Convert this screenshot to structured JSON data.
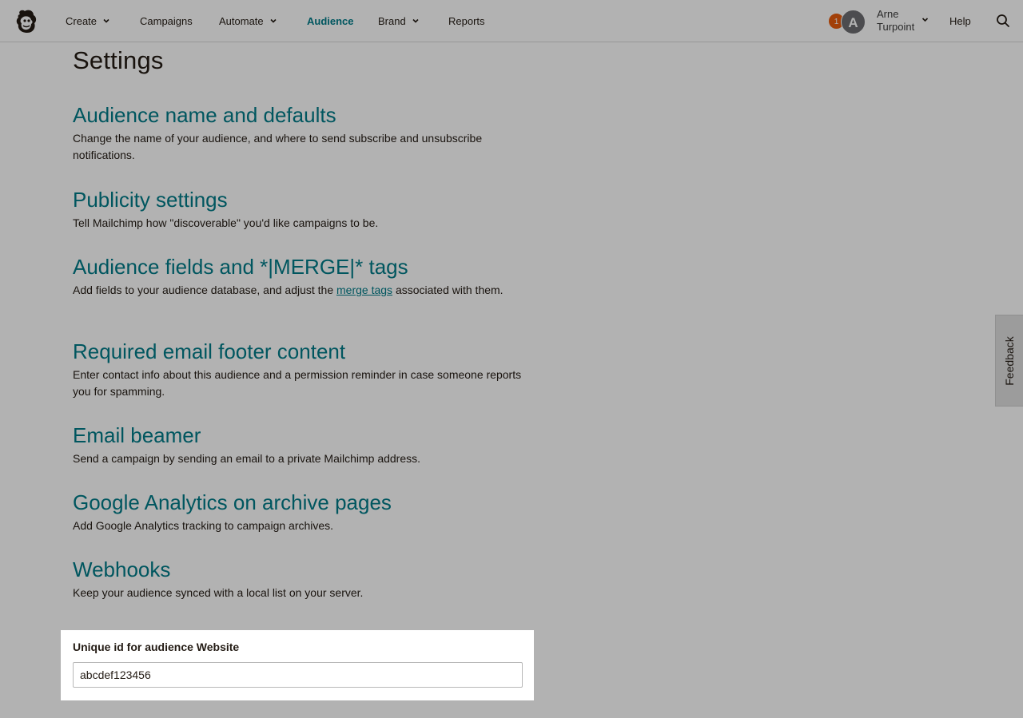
{
  "nav": {
    "logo": "mailchimp-logo",
    "items": [
      {
        "label": "Create",
        "has_dropdown": true
      },
      {
        "label": "Campaigns",
        "has_dropdown": false
      },
      {
        "label": "Automate",
        "has_dropdown": true
      },
      {
        "label": "Audience",
        "has_dropdown": false,
        "active": true
      },
      {
        "label": "Brand",
        "has_dropdown": true
      },
      {
        "label": "Reports",
        "has_dropdown": false
      }
    ],
    "notification_count": "1",
    "avatar_initial": "A",
    "user_first": "Arne",
    "user_last": "Turpoint",
    "help": "Help",
    "search_icon": "search-icon"
  },
  "page": {
    "title": "Settings",
    "sections": [
      {
        "title": "Audience name and defaults",
        "description": "Change the name of your audience, and where to send subscribe and unsubscribe notifications."
      },
      {
        "title": "Publicity settings",
        "description": "Tell Mailchimp how \"discoverable\" you'd like campaigns to be."
      },
      {
        "title": "Audience fields and *|MERGE|* tags",
        "description_before": "Add fields to your audience database, and adjust the ",
        "description_link": "merge tags",
        "description_after": " associated with them."
      },
      {
        "title": "Required email footer content",
        "description": "Enter contact info about this audience and a permission reminder in case someone reports you for spamming."
      },
      {
        "title": "Email beamer",
        "description": "Send a campaign by sending an email to a private Mailchimp address."
      },
      {
        "title": "Google Analytics on archive pages",
        "description": "Add Google Analytics tracking to campaign archives."
      },
      {
        "title": "Webhooks",
        "description": "Keep your audience synced with a local list on your server."
      }
    ],
    "unique_id": {
      "label": "Unique id for audience Website",
      "value": "abcdef123456"
    }
  },
  "feedback": "Feedback",
  "colors": {
    "accent": "#007c89",
    "badge": "#e85c0d",
    "text": "#241c15"
  }
}
